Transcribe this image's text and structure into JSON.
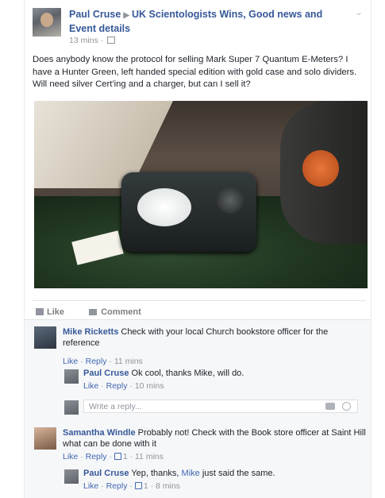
{
  "post": {
    "author": "Paul Cruse",
    "group": "UK Scientologists Wins, Good news and Event details",
    "time": "13 mins",
    "text": "Does anybody know the protocol for selling Mark Super 7 Quantum E-Meters? I have a Hunter Green, left handed special edition with gold case and solo dividers. Will need silver Cert'ing and a charger, but can I sell it?",
    "like_label": "Like",
    "comment_label": "Comment"
  },
  "comments": [
    {
      "author": "Mike Ricketts",
      "text": "Check with your local Church bookstore officer for the reference",
      "like": "Like",
      "reply": "Reply",
      "time": "11 mins",
      "replies": [
        {
          "author": "Paul Cruse",
          "text": "Ok cool, thanks Mike, will do.",
          "like": "Like",
          "reply": "Reply",
          "time": "10 mins"
        }
      ]
    },
    {
      "author": "Samantha Windle",
      "text": "Probably not! Check with the Book store officer at Saint Hill what can be done with it",
      "like": "Like",
      "reply": "Reply",
      "likes_count": "1",
      "time": "11 mins",
      "replies": [
        {
          "author": "Paul Cruse",
          "text_before": "Yep, thanks,",
          "mention": "Mike",
          "text_after": "just said the same.",
          "like": "Like",
          "reply": "Reply",
          "likes_count": "1",
          "time": "8 mins"
        }
      ]
    }
  ],
  "reply_box": {
    "placeholder": "Write a reply..."
  },
  "icons": {
    "globe": "globe-icon",
    "chevron": "chevron-down-icon",
    "like": "thumbs-up-icon",
    "comment": "comment-icon",
    "camera": "camera-icon",
    "emoji": "emoji-icon"
  },
  "colors": {
    "link": "#365899",
    "meta": "#90949c",
    "comment_bg": "#f6f7f9"
  }
}
